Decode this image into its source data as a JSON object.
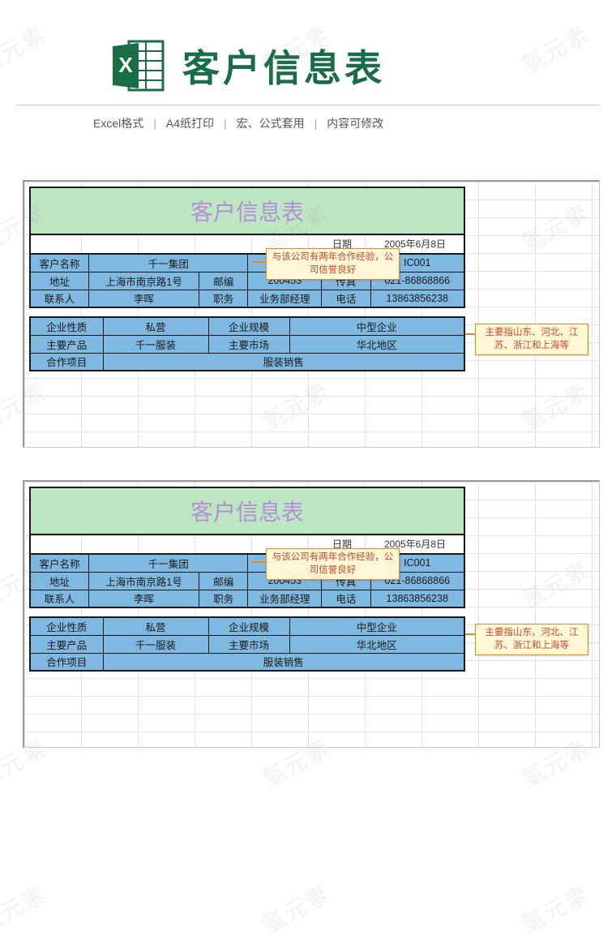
{
  "watermark": "氢元素",
  "header": {
    "title": "客户信息表",
    "icon_label": "X"
  },
  "subbar": {
    "fmt": "Excel格式",
    "paper": "A4纸打印",
    "macro": "宏、公式套用",
    "editable": "内容可修改"
  },
  "sheet": {
    "title": "客户信息表",
    "date_label": "日期",
    "date_value": "2005年6月8日",
    "block1": {
      "r1": {
        "c1": "客户名称",
        "c2": "千一集团",
        "c3": "",
        "c4": "IC001"
      },
      "r2": {
        "c1": "地址",
        "c2": "上海市南京路1号",
        "c3": "邮编",
        "c4": "200453",
        "c5": "传真",
        "c6": "021-86868866"
      },
      "r3": {
        "c1": "联系人",
        "c2": "李晖",
        "c3": "职务",
        "c4": "业务部经理",
        "c5": "电话",
        "c6": "13863856238"
      }
    },
    "block2": {
      "r1": {
        "c1": "企业性质",
        "c2": "私营",
        "c3": "企业规模",
        "c4": "中型企业"
      },
      "r2": {
        "c1": "主要产品",
        "c2": "千一服装",
        "c3": "主要市场",
        "c4": "华北地区"
      },
      "r3": {
        "c1": "合作项目",
        "c2": "服装销售"
      }
    },
    "callout1": "与该公司有两年合作经验，公司信誉良好",
    "callout2": "主要指山东、河北、江苏、浙江和上海等"
  }
}
